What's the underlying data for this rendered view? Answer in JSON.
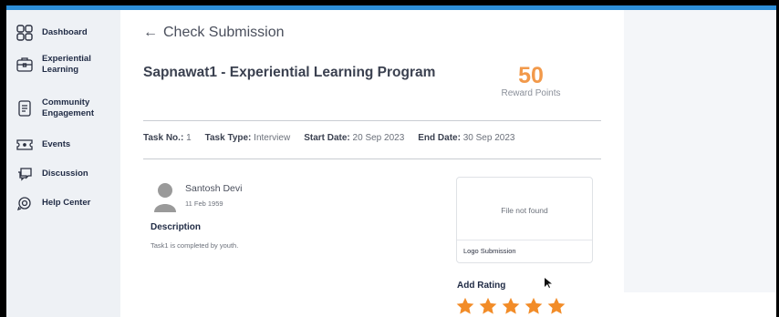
{
  "sidebar": {
    "items": [
      {
        "label": "Dashboard",
        "icon": "dashboard-icon"
      },
      {
        "label": "Experiential Learning",
        "icon": "briefcase-icon"
      },
      {
        "label": "Community Engagement",
        "icon": "document-icon"
      },
      {
        "label": "Events",
        "icon": "ticket-icon"
      },
      {
        "label": "Discussion",
        "icon": "chat-icon"
      },
      {
        "label": "Help Center",
        "icon": "headset-icon"
      }
    ]
  },
  "header": {
    "back_label": "Check Submission"
  },
  "program": {
    "title": "Sapnawat1 - Experiential Learning Program",
    "points_value": "50",
    "points_label": "Reward Points"
  },
  "task": {
    "no_label": "Task No.:",
    "no_value": "1",
    "type_label": "Task Type:",
    "type_value": "Interview",
    "start_label": "Start Date:",
    "start_value": "20 Sep 2023",
    "end_label": "End Date:",
    "end_value": "30 Sep 2023"
  },
  "submission": {
    "user_name": "Santosh Devi",
    "user_date": "11 Feb 1959",
    "description_heading": "Description",
    "description_text": "Task1 is completed by youth.",
    "file_status": "File not found",
    "file_caption": "Logo Submission"
  },
  "rating": {
    "heading": "Add Rating",
    "value": 5,
    "max": 5
  },
  "colors": {
    "accent": "#f2994a",
    "topbar": "#2e8fd8",
    "star": "#f28c28",
    "sidebar_bg": "#eef1f5"
  }
}
